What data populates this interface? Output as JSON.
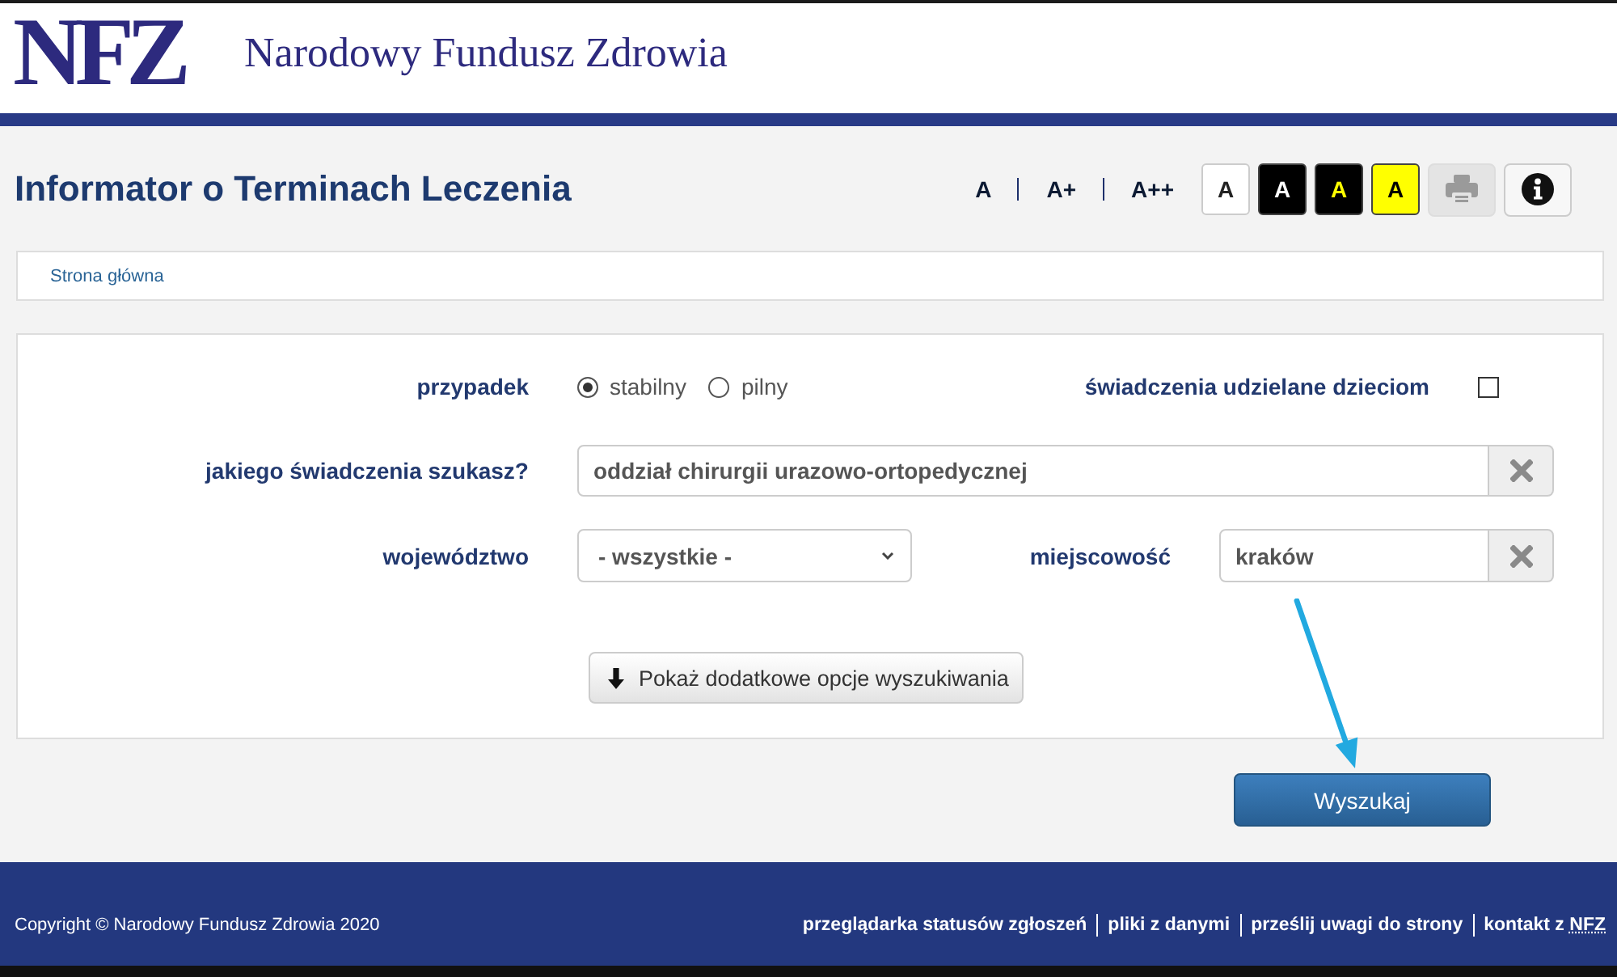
{
  "header": {
    "logo": "NFZ",
    "title": "Narodowy Fundusz Zdrowia"
  },
  "page_title": "Informator o Terminach Leczenia",
  "font_size_options": [
    {
      "label": "A"
    },
    {
      "label": "A+"
    },
    {
      "label": "A++"
    }
  ],
  "contrast_options": [
    {
      "label": "A",
      "kind": "white"
    },
    {
      "label": "A",
      "kind": "black"
    },
    {
      "label": "A",
      "kind": "black-yellow"
    },
    {
      "label": "A",
      "kind": "yellow"
    }
  ],
  "tool_buttons": [
    {
      "kind": "print",
      "disabled": true
    },
    {
      "kind": "info",
      "disabled": false
    }
  ],
  "breadcrumb": [
    {
      "label": "Strona główna"
    }
  ],
  "form": {
    "case": {
      "label": "przypadek",
      "options": [
        {
          "label": "stabilny",
          "selected": true
        },
        {
          "label": "pilny",
          "selected": false
        }
      ]
    },
    "children_only": {
      "label": "świadczenia udzielane dzieciom",
      "checked": false
    },
    "service": {
      "label": "jakiego świadczenia szukasz?",
      "value": "oddział chirurgii urazowo-ortopedycznej"
    },
    "province": {
      "label": "województwo",
      "value": "- wszystkie -"
    },
    "locality": {
      "label": "miejscowość",
      "value": "kraków"
    },
    "more_options_button": "Pokaż dodatkowe opcje wyszukiwania"
  },
  "search_button": "Wyszukaj",
  "footer": {
    "copyright": "Copyright © Narodowy Fundusz Zdrowia 2020",
    "links": [
      {
        "label": "przeglądarka statusów zgłoszeń"
      },
      {
        "label": "pliki z danymi"
      },
      {
        "label": "prześlij uwagi do strony"
      },
      {
        "label": "kontakt z",
        "abbr": "NFZ"
      }
    ]
  }
}
